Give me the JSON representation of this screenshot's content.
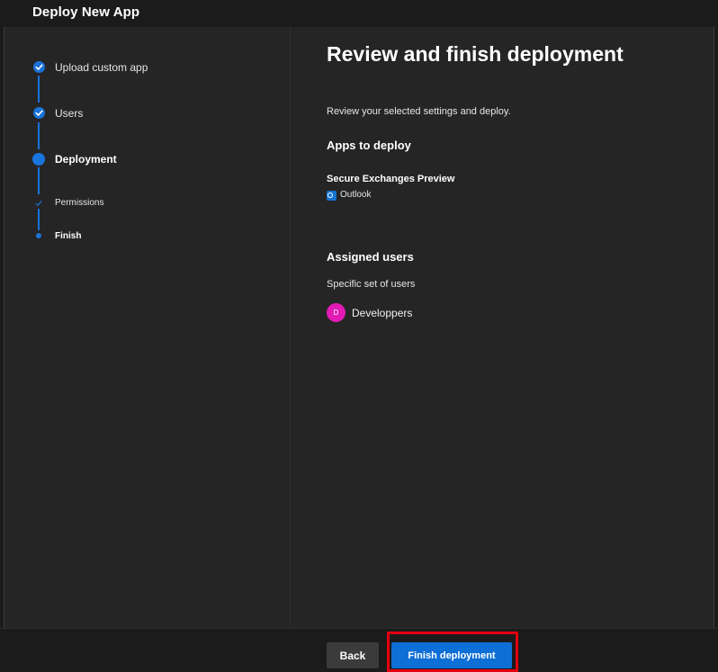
{
  "window": {
    "title": "Deploy New App"
  },
  "steps": [
    {
      "label": "Upload custom app",
      "state": "complete"
    },
    {
      "label": "Users",
      "state": "complete"
    },
    {
      "label": "Deployment",
      "state": "current"
    },
    {
      "label": "Permissions",
      "state": "complete-substep"
    },
    {
      "label": "Finish",
      "state": "current-substep"
    }
  ],
  "review": {
    "heading": "Review and finish deployment",
    "description": "Review your selected settings and deploy.",
    "apps_title": "Apps to deploy",
    "app_name": "Secure Exchanges Preview",
    "host_icon": "outlook-icon",
    "host_label": "Outlook",
    "users_title": "Assigned users",
    "users_description": "Specific set of users",
    "group": {
      "avatar_initial": "D",
      "name": "Developpers",
      "avatar_color": "#e11bb4"
    }
  },
  "footer": {
    "back_label": "Back",
    "finish_label": "Finish deployment",
    "highlight_color": "#e3000f"
  },
  "colors": {
    "accent": "#1a73d9",
    "background": "#252525"
  }
}
